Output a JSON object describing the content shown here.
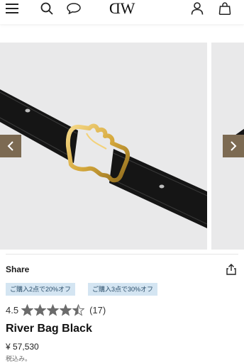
{
  "header": {
    "brand_left": "D",
    "brand_right": "W",
    "icons": [
      "menu-icon",
      "search-icon",
      "chat-icon",
      "account-icon",
      "bag-icon"
    ]
  },
  "gallery": {
    "prev_icon": "chevron-left-icon",
    "next_icon": "chevron-right-icon",
    "arrow_color": "#7c6a52"
  },
  "share": {
    "label": "Share",
    "icon": "share-icon"
  },
  "promos": [
    "ご購入2点で20%オフ",
    "ご購入3点で30%オフ"
  ],
  "rating": {
    "value": "4.5",
    "stars": 4.5,
    "max_stars": 5,
    "count": "(17)"
  },
  "product": {
    "title": "River Bag Black",
    "price": "¥ 57,530",
    "tax_note": "税込み。"
  },
  "colors": {
    "promo_bg": "#d4e5f2",
    "star": "#6b6b6b",
    "arrow": "#7c6a52"
  }
}
